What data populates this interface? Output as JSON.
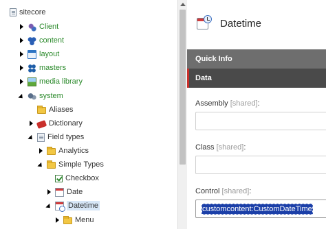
{
  "tree": {
    "items": [
      {
        "label": "sitecore",
        "color": "dark"
      },
      {
        "label": "Client",
        "color": "green"
      },
      {
        "label": "content",
        "color": "green"
      },
      {
        "label": "layout",
        "color": "green"
      },
      {
        "label": "masters",
        "color": "green"
      },
      {
        "label": "media library",
        "color": "green"
      },
      {
        "label": "system",
        "color": "green"
      },
      {
        "label": "Aliases",
        "color": "dark"
      },
      {
        "label": "Dictionary",
        "color": "dark"
      },
      {
        "label": "Field types",
        "color": "dark"
      },
      {
        "label": "Analytics",
        "color": "dark"
      },
      {
        "label": "Simple Types",
        "color": "dark"
      },
      {
        "label": "Checkbox",
        "color": "dark"
      },
      {
        "label": "Date",
        "color": "dark"
      },
      {
        "label": "Datetime",
        "color": "dark",
        "selected": true
      },
      {
        "label": "Menu",
        "color": "dark"
      }
    ]
  },
  "editor": {
    "title": "Datetime",
    "sections": {
      "quick_info": "Quick Info",
      "data": "Data"
    },
    "fields": [
      {
        "label": "Assembly",
        "shared": "[shared]",
        "suffix": ":",
        "value": ""
      },
      {
        "label": "Class",
        "shared": "[shared]",
        "suffix": ":",
        "value": ""
      },
      {
        "label": "Control",
        "shared": "[shared]",
        "suffix": ":",
        "value": "customcontent:CustomDateTime"
      }
    ]
  },
  "colors": {
    "tree_label_green": "#2b8a2b",
    "section_quickinfo": "#6e6e6e",
    "section_data": "#4a4a4a",
    "section_data_accent": "#c8302b",
    "selection": "#1b3fa8"
  }
}
